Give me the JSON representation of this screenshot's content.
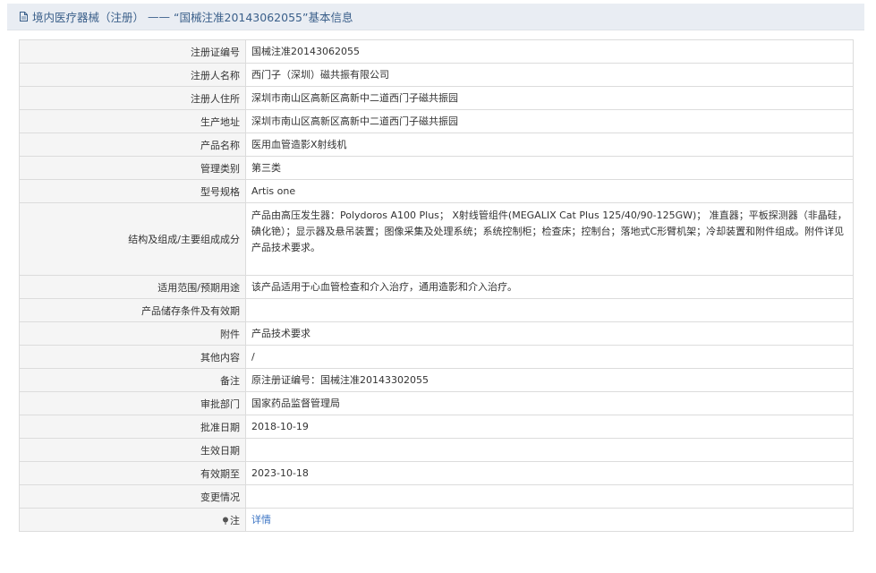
{
  "header": {
    "section": "境内医疗器械（注册）",
    "separator": "——",
    "title": "“国械注准20143062055”基本信息"
  },
  "rows": [
    {
      "label": "注册证编号",
      "value": "国械注准20143062055"
    },
    {
      "label": "注册人名称",
      "value": "西门子（深圳）磁共振有限公司"
    },
    {
      "label": "注册人住所",
      "value": "深圳市南山区高新区高新中二道西门子磁共振园"
    },
    {
      "label": "生产地址",
      "value": "深圳市南山区高新区高新中二道西门子磁共振园"
    },
    {
      "label": "产品名称",
      "value": "医用血管造影X射线机"
    },
    {
      "label": "管理类别",
      "value": "第三类"
    },
    {
      "label": "型号规格",
      "value": "Artis one"
    },
    {
      "label": "结构及组成/主要组成成分",
      "value": "产品由高压发生器：Polydoros A100 Plus； X射线管组件(MEGALIX Cat Plus 125/40/90-125GW)； 准直器；平板探测器（非晶硅，碘化铯）；显示器及悬吊装置；图像采集及处理系统；系统控制柜；检查床；控制台；落地式C形臂机架；冷却装置和附件组成。附件详见产品技术要求。"
    },
    {
      "label": "适用范围/预期用途",
      "value": "该产品适用于心血管检查和介入治疗，通用造影和介入治疗。"
    },
    {
      "label": "产品储存条件及有效期",
      "value": ""
    },
    {
      "label": "附件",
      "value": "产品技术要求"
    },
    {
      "label": "其他内容",
      "value": "/"
    },
    {
      "label": "备注",
      "value": "原注册证编号：国械注准20143302055"
    },
    {
      "label": "审批部门",
      "value": "国家药品监督管理局"
    },
    {
      "label": "批准日期",
      "value": "2018-10-19"
    },
    {
      "label": "生效日期",
      "value": ""
    },
    {
      "label": "有效期至",
      "value": "2023-10-18"
    },
    {
      "label": "变更情况",
      "value": ""
    }
  ],
  "note": {
    "label": "注",
    "link": "详情",
    "icon": "pin-icon"
  },
  "colors": {
    "header_bg": "#e9edf3",
    "header_text": "#3a5f8a",
    "label_bg": "#f5f5f5",
    "link": "#3b74c4"
  }
}
